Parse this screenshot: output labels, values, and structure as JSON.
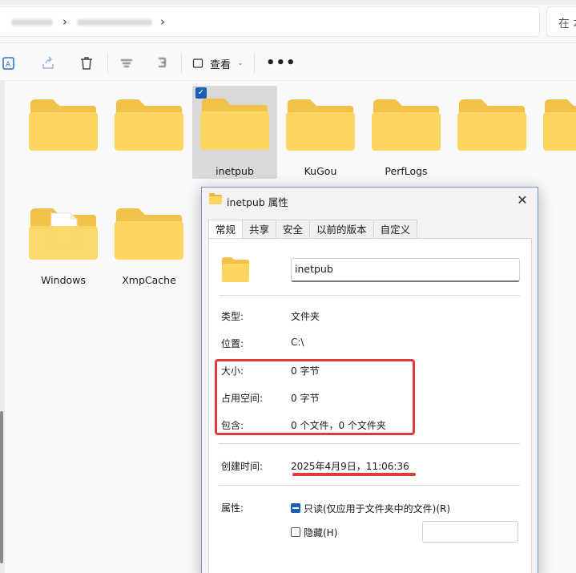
{
  "search": {
    "placeholder": "在 本"
  },
  "toolbar": {
    "view_label": "查看",
    "more_label": "•••"
  },
  "folders": [
    {
      "name": ""
    },
    {
      "name": ""
    },
    {
      "name": "inetpub"
    },
    {
      "name": "KuGou"
    },
    {
      "name": "PerfLogs"
    },
    {
      "name": ""
    },
    {
      "name": ""
    },
    {
      "name": "Windows"
    },
    {
      "name": "XmpCache"
    }
  ],
  "dialog": {
    "title": "inetpub 属性",
    "tabs": [
      {
        "label": "常规"
      },
      {
        "label": "共享"
      },
      {
        "label": "安全"
      },
      {
        "label": "以前的版本"
      },
      {
        "label": "自定义"
      }
    ],
    "name_value": "inetpub",
    "type_label": "类型:",
    "type_value": "文件夹",
    "location_label": "位置:",
    "location_value": "C:\\",
    "size_label": "大小:",
    "size_value": "0 字节",
    "disk_size_label": "占用空间:",
    "disk_size_value": "0 字节",
    "contains_label": "包含:",
    "contains_value": "0 个文件，0 个文件夹",
    "created_label": "创建时间:",
    "created_value": "2025年4月9日，11:06:36",
    "attributes_label": "属性:",
    "readonly_label": "只读(仅应用于文件夹中的文件)(R)",
    "readonly_checked": true,
    "hidden_label": "隐藏(H)",
    "hidden_checked": false
  },
  "colors": {
    "folder_back": "#f1c24a",
    "folder_front": "#fcd661",
    "highlight_red": "#e03a3e",
    "accent_blue": "#1a5fb4",
    "selection_gray": "#d9d9d9"
  }
}
